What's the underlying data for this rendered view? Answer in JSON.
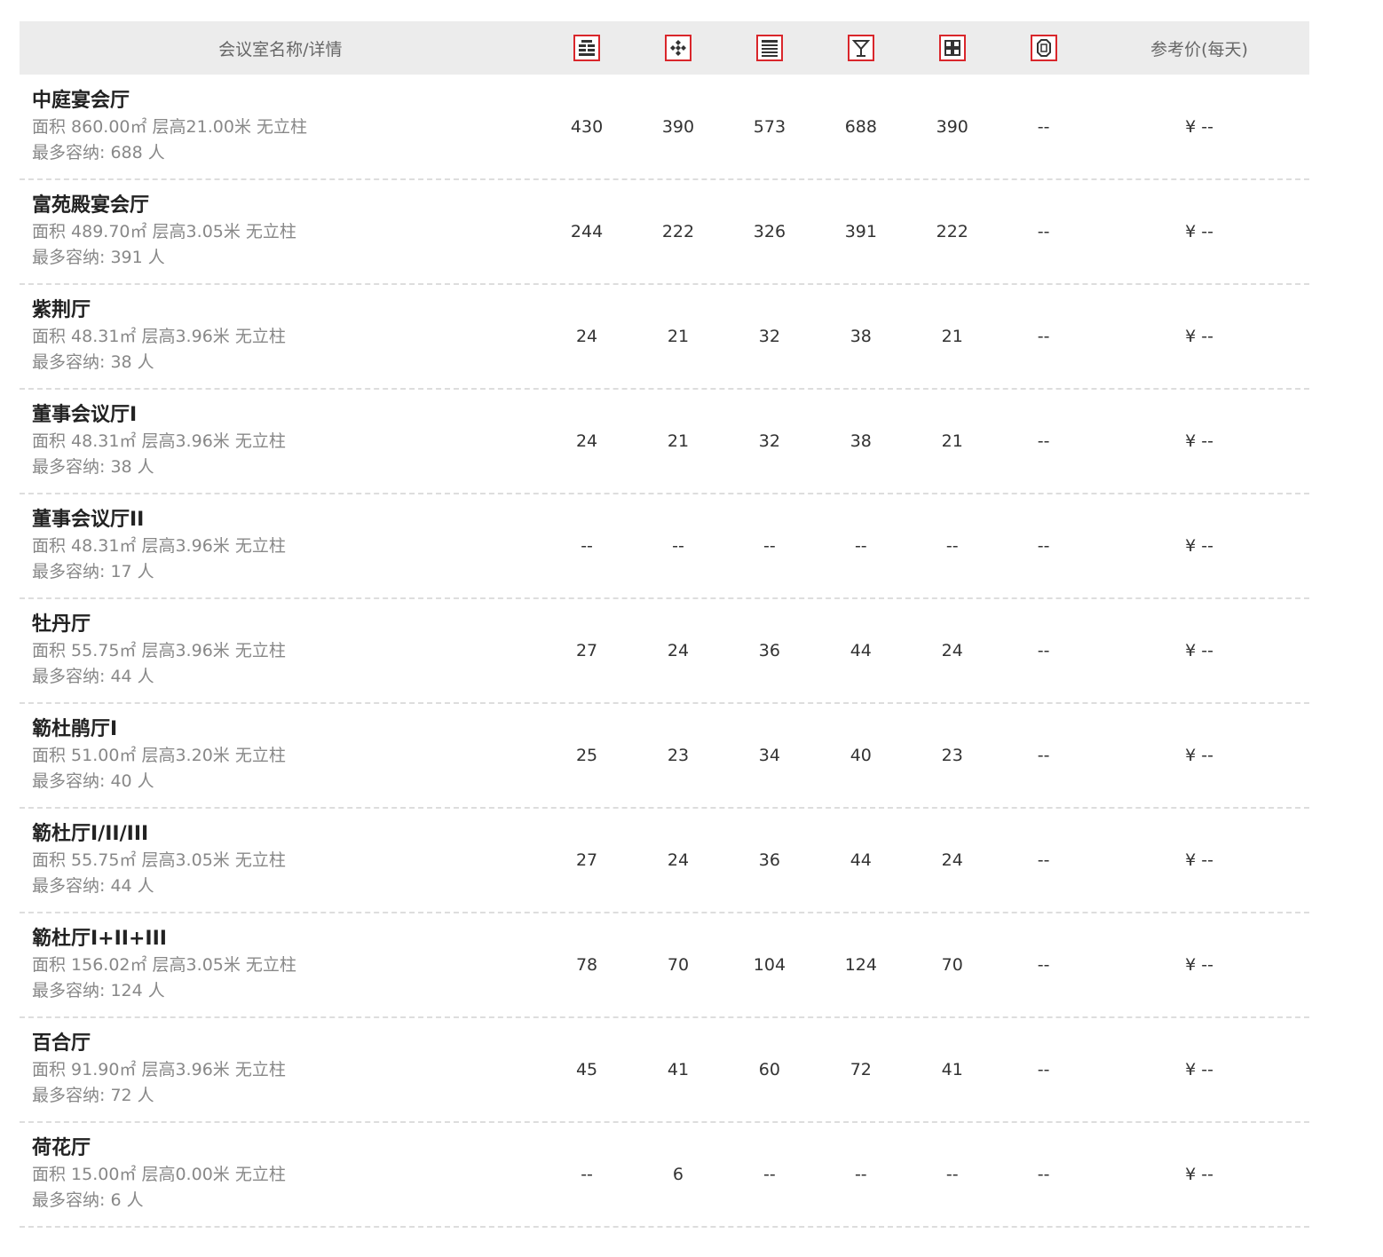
{
  "header": {
    "name_label": "会议室名称/详情",
    "price_label": "参考价(每天)",
    "icons": [
      "theater-layout-icon",
      "banquet-layout-icon",
      "classroom-layout-icon",
      "cocktail-layout-icon",
      "island-layout-icon",
      "boardroom-layout-icon"
    ],
    "accent_color": "#d9262b"
  },
  "rooms": [
    {
      "name": "中庭宴会厅",
      "detail": "面积 860.00㎡ 层高21.00米 无立柱",
      "capacity": "最多容纳: 688 人",
      "values": [
        "430",
        "390",
        "573",
        "688",
        "390",
        "--"
      ],
      "price": "¥ --"
    },
    {
      "name": "富苑殿宴会厅",
      "detail": "面积 489.70㎡ 层高3.05米 无立柱",
      "capacity": "最多容纳: 391 人",
      "values": [
        "244",
        "222",
        "326",
        "391",
        "222",
        "--"
      ],
      "price": "¥ --"
    },
    {
      "name": "紫荆厅",
      "detail": "面积 48.31㎡ 层高3.96米 无立柱",
      "capacity": "最多容纳: 38 人",
      "values": [
        "24",
        "21",
        "32",
        "38",
        "21",
        "--"
      ],
      "price": "¥ --"
    },
    {
      "name": "董事会议厅I",
      "detail": "面积 48.31㎡ 层高3.96米 无立柱",
      "capacity": "最多容纳: 38 人",
      "values": [
        "24",
        "21",
        "32",
        "38",
        "21",
        "--"
      ],
      "price": "¥ --"
    },
    {
      "name": "董事会议厅II",
      "detail": "面积 48.31㎡ 层高3.96米 无立柱",
      "capacity": "最多容纳: 17 人",
      "values": [
        "--",
        "--",
        "--",
        "--",
        "--",
        "--"
      ],
      "price": "¥ --"
    },
    {
      "name": "牡丹厅",
      "detail": "面积 55.75㎡ 层高3.96米 无立柱",
      "capacity": "最多容纳: 44 人",
      "values": [
        "27",
        "24",
        "36",
        "44",
        "24",
        "--"
      ],
      "price": "¥ --"
    },
    {
      "name": "簕杜鹃厅I",
      "detail": "面积 51.00㎡ 层高3.20米 无立柱",
      "capacity": "最多容纳: 40 人",
      "values": [
        "25",
        "23",
        "34",
        "40",
        "23",
        "--"
      ],
      "price": "¥ --"
    },
    {
      "name": "簕杜厅I/II/III",
      "detail": "面积 55.75㎡ 层高3.05米 无立柱",
      "capacity": "最多容纳: 44 人",
      "values": [
        "27",
        "24",
        "36",
        "44",
        "24",
        "--"
      ],
      "price": "¥ --"
    },
    {
      "name": "簕杜厅I+II+III",
      "detail": "面积 156.02㎡ 层高3.05米 无立柱",
      "capacity": "最多容纳: 124 人",
      "values": [
        "78",
        "70",
        "104",
        "124",
        "70",
        "--"
      ],
      "price": "¥ --"
    },
    {
      "name": "百合厅",
      "detail": "面积 91.90㎡ 层高3.96米 无立柱",
      "capacity": "最多容纳: 72 人",
      "values": [
        "45",
        "41",
        "60",
        "72",
        "41",
        "--"
      ],
      "price": "¥ --"
    },
    {
      "name": "荷花厅",
      "detail": "面积 15.00㎡ 层高0.00米 无立柱",
      "capacity": "最多容纳: 6 人",
      "values": [
        "--",
        "6",
        "--",
        "--",
        "--",
        "--"
      ],
      "price": "¥ --"
    }
  ]
}
